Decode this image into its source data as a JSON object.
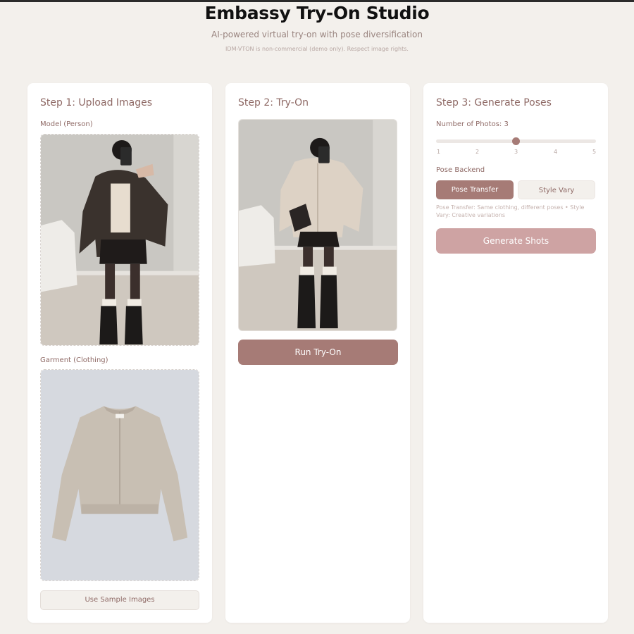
{
  "header": {
    "title": "Embassy Try-On Studio",
    "subtitle": "AI-powered virtual try-on with pose diversification",
    "notice": "IDM-VTON is non-commercial (demo only). Respect image rights."
  },
  "step1": {
    "heading": "Step 1: Upload Images",
    "model_label": "Model (Person)",
    "garment_label": "Garment (Clothing)",
    "sample_button": "Use Sample Images"
  },
  "step2": {
    "heading": "Step 2: Try-On",
    "run_button": "Run Try-On"
  },
  "step3": {
    "heading": "Step 3: Generate Poses",
    "photos_label": "Number of Photos: 3",
    "slider": {
      "min": 1,
      "max": 5,
      "value": 3,
      "ticks": [
        "1",
        "2",
        "3",
        "4",
        "5"
      ]
    },
    "backend_label": "Pose Backend",
    "backend_options": [
      "Pose Transfer",
      "Style Vary"
    ],
    "backend_selected": "Pose Transfer",
    "help_text": "Pose Transfer: Same clothing, different poses • Style Vary: Creative variations",
    "generate_button": "Generate Shots"
  },
  "colors": {
    "accent": "#a67b76",
    "accent_light": "#cea3a3",
    "background": "#f3f0ec",
    "text": "#8f6a66"
  }
}
